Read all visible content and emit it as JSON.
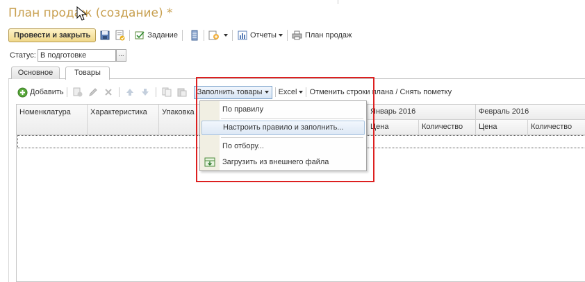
{
  "window": {
    "title": "План продаж (создание) *"
  },
  "toolbar": {
    "post_and_close": "Провести и закрыть",
    "task": "Задание",
    "reports": "Отчеты",
    "sales_plan": "План продаж"
  },
  "status": {
    "label": "Статус:",
    "value": "В подготовке",
    "select_btn": "..."
  },
  "tabs": [
    {
      "label": "Основное",
      "active": false
    },
    {
      "label": "Товары",
      "active": true
    }
  ],
  "table_toolbar": {
    "add": "Добавить",
    "fill_goods": "Заполнить товары",
    "excel": "Excel",
    "cancel_rows": "Отменить строки плана / Снять пометку"
  },
  "table": {
    "columns": [
      "Номенклатура",
      "Характеристика",
      "Упаковка"
    ],
    "period_groups": [
      {
        "label": "Январь 2016",
        "subcolumns": [
          "Цена",
          "Количество"
        ]
      },
      {
        "label": "Февраль 2016",
        "subcolumns": [
          "Цена",
          "Количество"
        ]
      }
    ]
  },
  "fill_menu": {
    "items": [
      {
        "label": "По правилу",
        "highlighted": false
      },
      {
        "label": "Настроить правило и заполнить...",
        "highlighted": true
      },
      {
        "label": "По отбору...",
        "highlighted": false
      },
      {
        "label": "Загрузить из внешнего файла",
        "highlighted": false,
        "icon": "import-file-icon"
      }
    ]
  },
  "colors": {
    "title": "#c8a050",
    "highlight_frame": "#dd2020",
    "primary_button": "#f0d88a"
  }
}
